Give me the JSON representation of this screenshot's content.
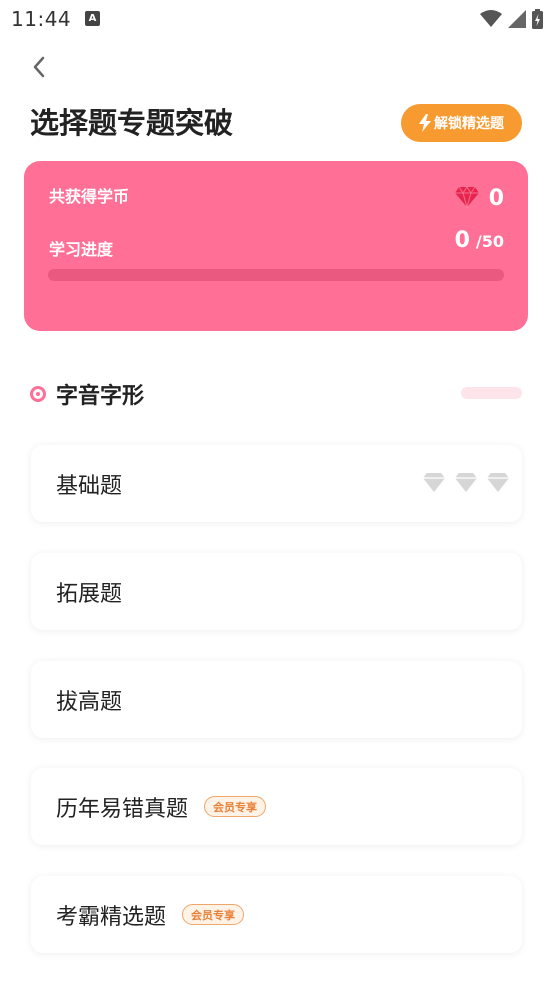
{
  "status_bar": {
    "time": "11:44",
    "notification_letter": "A"
  },
  "header": {
    "title": "选择题专题突破",
    "unlock_label": "解锁精选题"
  },
  "stats": {
    "coins_label": "共获得学币",
    "coins_value": "0",
    "progress_label": "学习进度",
    "progress_current": "0",
    "progress_total": "/50",
    "progress_fraction": 0
  },
  "section": {
    "title": "字音字形"
  },
  "items": [
    {
      "label": "基础题",
      "badge": ""
    },
    {
      "label": "拓展题",
      "badge": ""
    },
    {
      "label": "拔高题",
      "badge": ""
    },
    {
      "label": "历年易错真题",
      "badge": "会员专享"
    },
    {
      "label": "考霸精选题",
      "badge": "会员专享"
    }
  ],
  "colors": {
    "accent_pink": "#ff6f96",
    "unlock_orange": "#f79a2f",
    "gem_red": "#e8234d",
    "gem_gray": "#d6d6d6"
  },
  "icons": {
    "back": "chevron-left-icon",
    "unlock": "lightning-icon",
    "coin": "gem-icon",
    "stars": "gem-outline-icon"
  }
}
